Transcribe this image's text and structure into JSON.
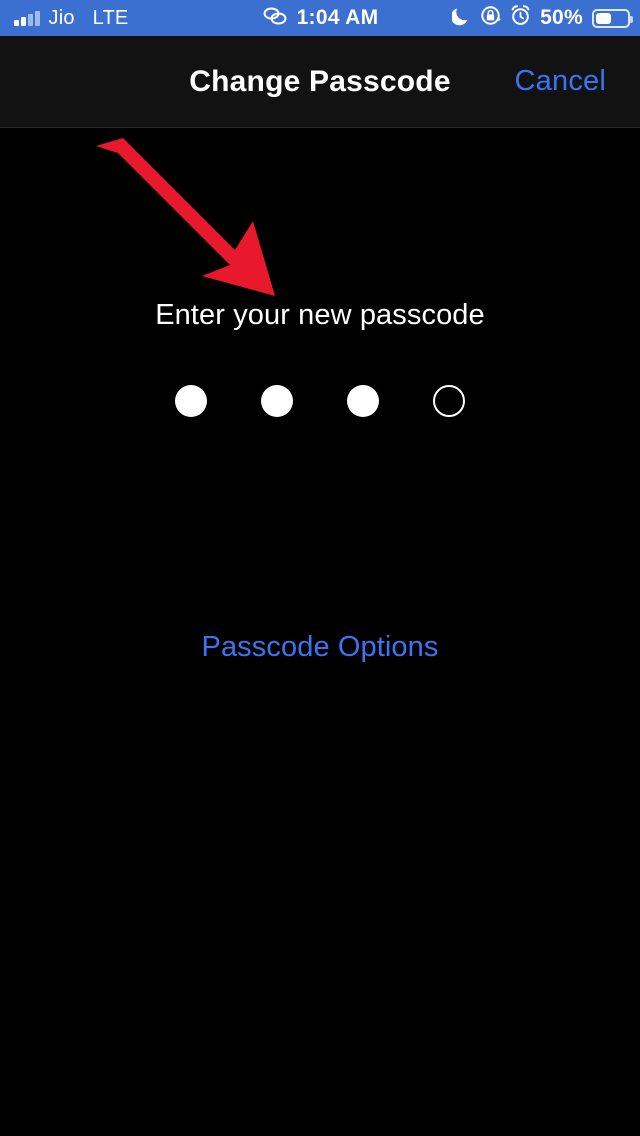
{
  "status_bar": {
    "carrier": "Jio",
    "network": "LTE",
    "time": "1:04 AM",
    "battery_percent": "50%",
    "battery_level": 50,
    "signal_bars_filled": 2,
    "signal_bars_total": 4,
    "icons": [
      "signal-bars-icon",
      "link-icon",
      "moon-do-not-disturb-icon",
      "rotation-lock-icon",
      "alarm-clock-icon",
      "battery-icon"
    ],
    "background_color": "#3b6fd0",
    "text_color": "#ffffff"
  },
  "nav_bar": {
    "title": "Change Passcode",
    "cancel_label": "Cancel",
    "background_color": "#121212",
    "title_color": "#ffffff",
    "accent_color": "#3a74f2"
  },
  "main": {
    "prompt": "Enter your new passcode",
    "passcode_options_label": "Passcode Options",
    "passcode": {
      "total_dots": 4,
      "filled_dots": 3,
      "dots": [
        "filled",
        "filled",
        "filled",
        "empty"
      ]
    },
    "background_color": "#000000",
    "text_color": "#ffffff",
    "link_color": "#3a74f2"
  },
  "annotation": {
    "type": "arrow",
    "direction": "down-right",
    "color": "#e8192c",
    "points_at": "Enter your new passcode"
  }
}
